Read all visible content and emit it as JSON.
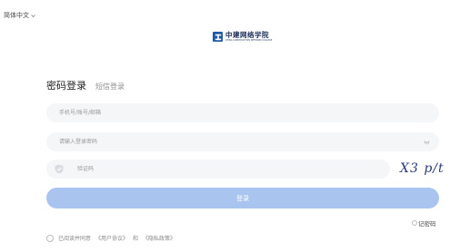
{
  "header": {
    "language": "简体中文"
  },
  "logo": {
    "name": "中建网络学院",
    "subtitle": "CHINA CONSTRUCTION NETWORK COLLEGE",
    "brand_color": "#1e5aa8"
  },
  "login": {
    "tabs": [
      {
        "label": "密码登录",
        "active": true
      },
      {
        "label": "短信登录",
        "active": false
      }
    ],
    "account_placeholder": "手机号/账号/邮箱",
    "password_placeholder": "请输入登录密码",
    "captcha_placeholder": "验证码",
    "captcha_image_text": "X3 p/t",
    "submit_label": "登录",
    "submit_color": "#a8c4ef",
    "remember_label": "记密码",
    "agreement": {
      "prefix": "已阅读并同意",
      "terms": "《用户协议》",
      "and": "和",
      "privacy": "《隐私政策》"
    }
  }
}
